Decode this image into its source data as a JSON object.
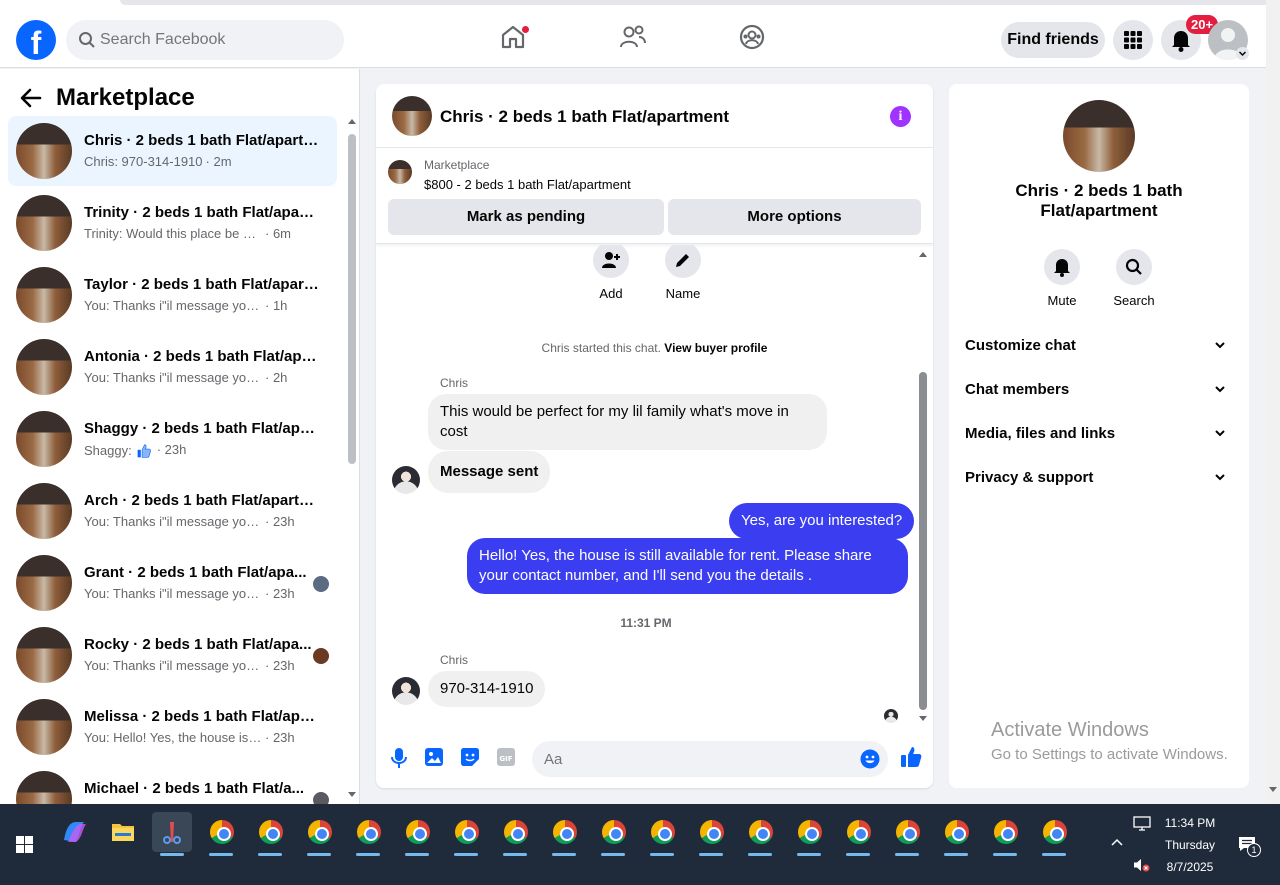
{
  "header": {
    "search_placeholder": "Search Facebook",
    "find_friends_label": "Find friends",
    "notifications_badge": "20+"
  },
  "left_panel": {
    "title": "Marketplace",
    "conversations": [
      {
        "title": "Chris · 2 beds 1 bath Flat/apartm...",
        "preview": "Chris: 970-314-1910",
        "time": "· 2m",
        "active": true
      },
      {
        "title": "Trinity · 2 beds 1 bath Flat/apart...",
        "preview": "Trinity: Would this place be shared?",
        "time": "· 6m"
      },
      {
        "title": "Taylor · 2 beds 1 bath Flat/apart...",
        "preview": "You: Thanks i\"il message you in a ...",
        "time": "· 1h"
      },
      {
        "title": "Antonia · 2 beds 1 bath Flat/apa...",
        "preview": "You: Thanks i\"il message you in a ...",
        "time": "· 2h"
      },
      {
        "title": "Shaggy · 2 beds 1 bath Flat/apar...",
        "preview": "Shaggy:",
        "time": "· 23h"
      },
      {
        "title": "Arch · 2 beds 1 bath Flat/apartm...",
        "preview": "You: Thanks i\"il message you in a ...",
        "time": "· 23h"
      },
      {
        "title": "Grant · 2 beds 1 bath Flat/apa...",
        "preview": "You: Thanks i\"il message you in...",
        "time": "· 23h"
      },
      {
        "title": "Rocky · 2 beds 1 bath Flat/apa...",
        "preview": "You: Thanks i\"il message you in...",
        "time": "· 23h"
      },
      {
        "title": "Melissa · 2 beds 1 bath Flat/apar...",
        "preview": "You: Hello! Yes, the house is still a...",
        "time": "· 23h"
      },
      {
        "title": "Michael · 2 beds 1 bath Flat/a...",
        "preview": "",
        "time": ""
      }
    ]
  },
  "chat": {
    "title": "Chris · 2 beds 1 bath Flat/apartment",
    "marketplace_label": "Marketplace",
    "listing": "$800 - 2 beds 1 bath Flat/apartment",
    "mark_pending_label": "Mark as pending",
    "more_options_label": "More options",
    "add_label": "Add",
    "name_label": "Name",
    "started_text": "Chris started this chat.",
    "view_buyer_profile": "View buyer profile",
    "sender_name": "Chris",
    "messages": [
      {
        "from": "Chris",
        "text": "This would be perfect for my lil family what's move in cost"
      },
      {
        "from": "Chris",
        "text": "Message sent"
      },
      {
        "from": "me",
        "text": "Yes, are you interested?"
      },
      {
        "from": "me",
        "text": "Hello! Yes, the house is still available for rent. Please share your contact number, and I'll send you the details ."
      },
      {
        "from": "Chris",
        "text": "970-314-1910"
      }
    ],
    "timestamp": "11:31 PM",
    "composer_placeholder": "Aa"
  },
  "right_panel": {
    "name": "Chris · 2 beds 1 bath Flat/apartment",
    "mute_label": "Mute",
    "search_label": "Search",
    "sections": [
      "Customize chat",
      "Chat members",
      "Media, files and links",
      "Privacy & support"
    ]
  },
  "watermark": {
    "line1": "Activate Windows",
    "line2": "Go to Settings to activate Windows."
  },
  "taskbar": {
    "time": "11:34 PM",
    "day": "Thursday",
    "date": "8/7/2025",
    "notification_count": "1"
  },
  "colors": {
    "facebook_blue": "#0866ff",
    "outgoing_bubble": "#3a3df0",
    "badge_red": "#e41e3f",
    "info_purple": "#a033ff"
  }
}
